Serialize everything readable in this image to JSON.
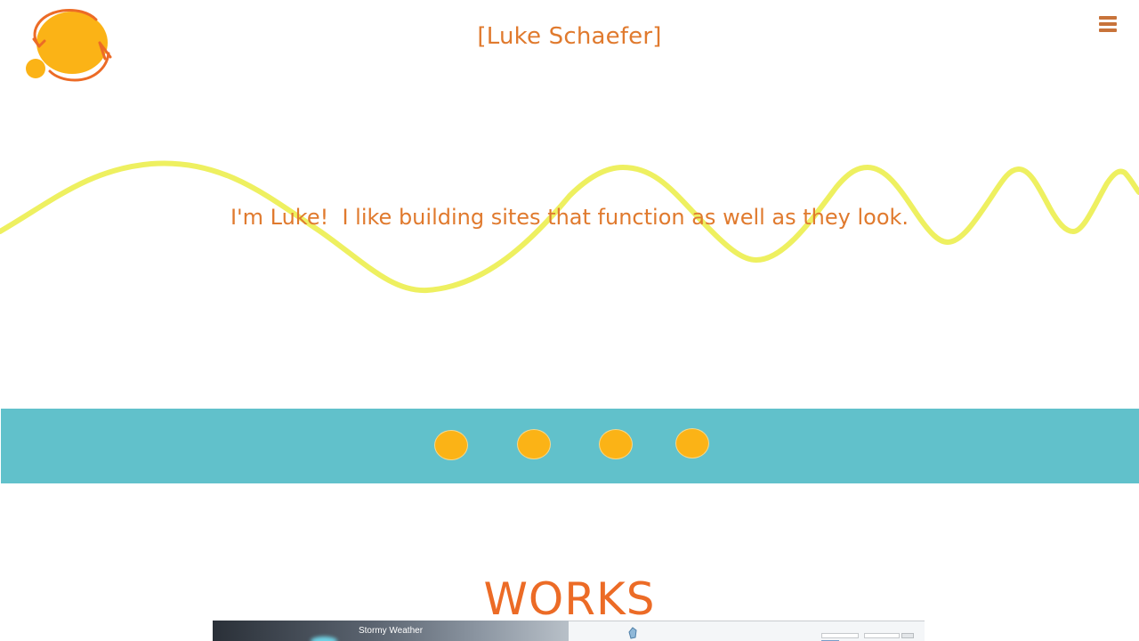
{
  "header": {
    "title": "[Luke Schaefer]",
    "logo_icon": "sun-orbit-logo-icon",
    "menu_icon": "hamburger-menu-icon"
  },
  "hero": {
    "tagline": "I'm Luke!  I like building sites that function as well as they look."
  },
  "carousel": {
    "dot_count": 4
  },
  "works": {
    "heading": "WORKS",
    "items": [
      {
        "caption": "Stormy Weather"
      },
      {
        "caption": ""
      }
    ]
  },
  "colors": {
    "accent_orange": "#e07a2e",
    "heading_orange": "#ec6b26",
    "wave_yellow": "#eef060",
    "band_teal": "#61c1cb",
    "dot_yellow": "#fbb316",
    "logo_yellow": "#fbb316",
    "logo_stroke": "#ec6b26"
  }
}
